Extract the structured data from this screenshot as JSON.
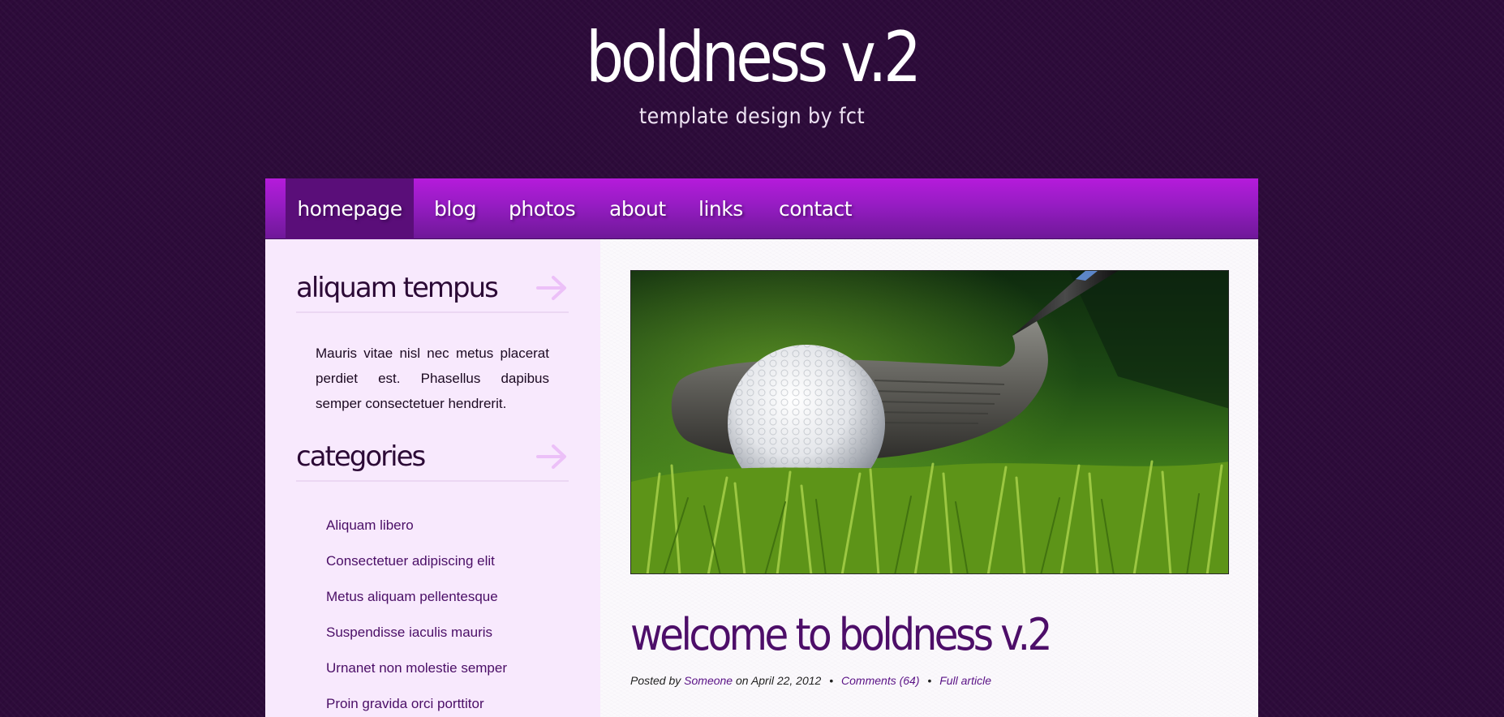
{
  "header": {
    "title": "boldness v.2",
    "tagline": "template design by fct"
  },
  "nav": {
    "items": [
      {
        "label": "homepage",
        "active": true
      },
      {
        "label": "blog",
        "active": false
      },
      {
        "label": "photos",
        "active": false
      },
      {
        "label": "about",
        "active": false
      },
      {
        "label": "links",
        "active": false
      },
      {
        "label": "contact",
        "active": false
      }
    ]
  },
  "sidebar": {
    "sections": [
      {
        "heading": "aliquam tempus",
        "icon": "arrow-right-icon",
        "text": "Mauris vitae nisl nec metus placerat perdiet est. Phasellus dapibus semper consectetuer hendrerit."
      },
      {
        "heading": "categories",
        "icon": "arrow-right-icon",
        "items": [
          "Aliquam libero",
          "Consectetuer adipiscing elit",
          "Metus aliquam pellentesque",
          "Suspendisse iaculis mauris",
          "Urnanet non molestie semper",
          "Proin gravida orci porttitor"
        ]
      }
    ]
  },
  "main": {
    "image": {
      "icon": "golf-ball-photo"
    },
    "post": {
      "title": "welcome to boldness v.2",
      "meta": {
        "posted_by_label": "Posted by",
        "author": "Someone",
        "on_label": "on",
        "date": "April 22, 2012",
        "separator": "•",
        "comments": "Comments (64)",
        "full_article": "Full article"
      }
    }
  },
  "colors": {
    "background": "#2d0b3a",
    "nav_top": "#b51bdb",
    "nav_bottom": "#6e1897",
    "nav_active": "#5a0e79",
    "sidebar_bg": "#f8e9fd",
    "accent_text": "#4d0e69",
    "link": "#5a1286",
    "arrow": "#ecc0f8"
  }
}
